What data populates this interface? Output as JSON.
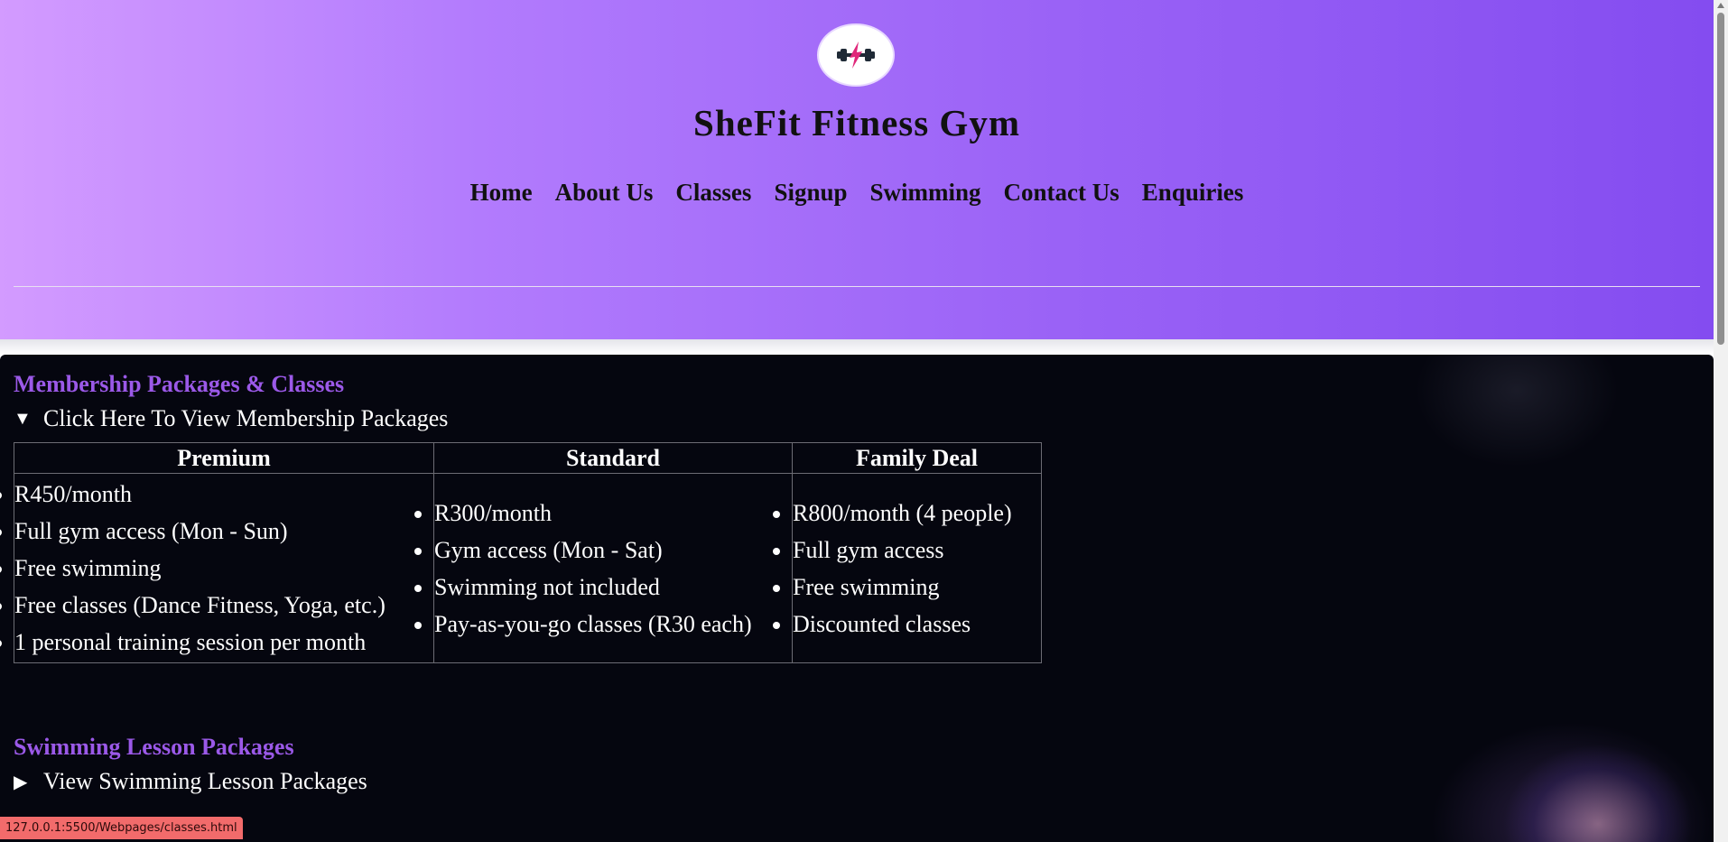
{
  "header": {
    "title": "SheFit Fitness Gym",
    "logo_icon": "dumbbell-lightning-icon",
    "nav": [
      {
        "label": "Home"
      },
      {
        "label": "About Us"
      },
      {
        "label": "Classes"
      },
      {
        "label": "Signup"
      },
      {
        "label": "Swimming"
      },
      {
        "label": "Contact Us"
      },
      {
        "label": "Enquiries"
      }
    ],
    "gradient_colors": [
      "#d39bff",
      "#844cf0"
    ]
  },
  "main": {
    "membership": {
      "heading": "Membership Packages & Classes",
      "summary": "Click Here To View Membership Packages",
      "expanded": true,
      "columns": [
        {
          "name": "Premium",
          "items": [
            "R450/month",
            "Full gym access (Mon - Sun)",
            "Free swimming",
            "Free classes (Dance Fitness, Yoga, etc.)",
            "1 personal training session per month"
          ]
        },
        {
          "name": "Standard",
          "items": [
            "R300/month",
            "Gym access (Mon - Sat)",
            "Swimming not included",
            "Pay-as-you-go classes (R30 each)"
          ]
        },
        {
          "name": "Family Deal",
          "items": [
            "R800/month (4 people)",
            "Full gym access",
            "Free swimming",
            "Discounted classes"
          ]
        }
      ]
    },
    "swimming": {
      "heading": "Swimming Lesson Packages",
      "summary": "View Swimming Lesson Packages",
      "expanded": false
    },
    "heading_color": "#9b59e8",
    "background_color": "#05060f"
  },
  "status_bar": {
    "url": "127.0.0.1:5500/Webpages/classes.html",
    "color": "#f26b6b"
  }
}
